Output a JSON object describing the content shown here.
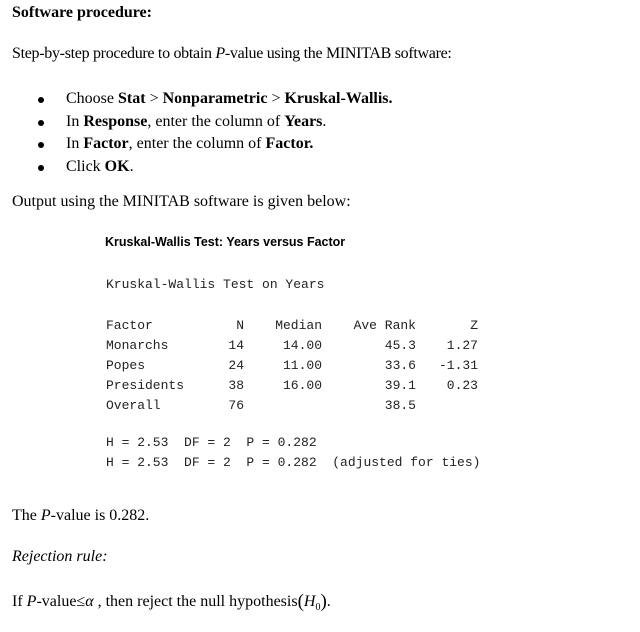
{
  "heading": "Software procedure:",
  "intro": {
    "pre": "Step-by-step procedure to obtain ",
    "italic": "P",
    "post": "-value using the MINITAB software:"
  },
  "steps": [
    {
      "parts": [
        {
          "t": "Choose ",
          "b": false
        },
        {
          "t": "Stat",
          "b": true
        },
        {
          "t": " > ",
          "b": false
        },
        {
          "t": "Nonparametric",
          "b": true
        },
        {
          "t": " > ",
          "b": false
        },
        {
          "t": "Kruskal-Wallis.",
          "b": true
        }
      ]
    },
    {
      "parts": [
        {
          "t": "In ",
          "b": false
        },
        {
          "t": "Response",
          "b": true
        },
        {
          "t": ", enter the column of ",
          "b": false
        },
        {
          "t": "Years",
          "b": true
        },
        {
          "t": ".",
          "b": false
        }
      ]
    },
    {
      "parts": [
        {
          "t": "In ",
          "b": false
        },
        {
          "t": "Factor",
          "b": true
        },
        {
          "t": ", enter the column of ",
          "b": false
        },
        {
          "t": "Factor.",
          "b": true
        }
      ]
    },
    {
      "parts": [
        {
          "t": "Click ",
          "b": false
        },
        {
          "t": "OK",
          "b": true
        },
        {
          "t": ".",
          "b": false
        }
      ]
    }
  ],
  "output_intro": "Output using the MINITAB software is given below:",
  "minitab": {
    "title": "Kruskal-Wallis Test: Years versus Factor",
    "subtitle": "Kruskal-Wallis Test on Years",
    "columns": [
      "Factor",
      "N",
      "Median",
      "Ave Rank",
      "Z"
    ],
    "rows": [
      [
        "Monarchs",
        "14",
        "14.00",
        "45.3",
        "1.27"
      ],
      [
        "Popes",
        "24",
        "11.00",
        "33.6",
        "-1.31"
      ],
      [
        "Presidents",
        "38",
        "16.00",
        "39.1",
        "0.23"
      ],
      [
        "Overall",
        "76",
        "",
        "38.5",
        ""
      ]
    ],
    "stat_line_1": "H = 2.53  DF = 2  P = 0.282",
    "stat_line_2": "H = 2.53  DF = 2  P = 0.282  (adjusted for ties)"
  },
  "pvalue_text": {
    "pre": "The ",
    "italic": "P",
    "post": "-value is 0.282."
  },
  "rejection_heading": "Rejection rule:",
  "rule": {
    "if": "If ",
    "p": "P",
    "value_leq": "-value≤",
    "alpha": "α",
    "then": " , then reject the null hypothesis",
    "lparen": "(",
    "H": "H",
    "sub": "0",
    "rparen": ")",
    "end": "."
  }
}
